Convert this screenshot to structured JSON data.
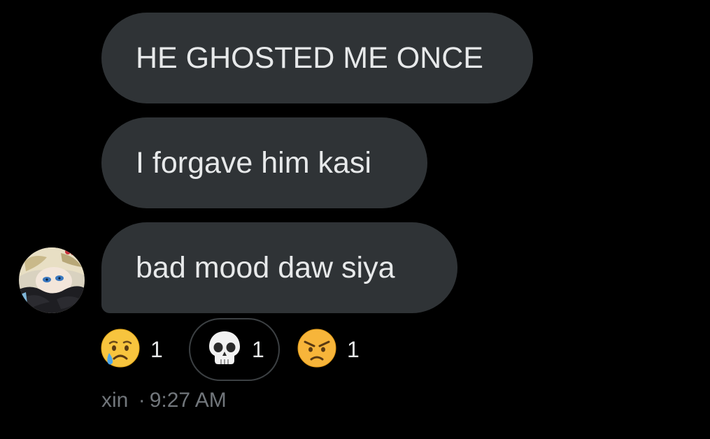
{
  "messages": [
    {
      "text": "HE GHOSTED ME ONCE"
    },
    {
      "text": "I forgave him kasi"
    },
    {
      "text": "bad mood daw siya"
    }
  ],
  "reactions": [
    {
      "emoji": "crying-face-icon",
      "count": "1"
    },
    {
      "emoji": "skull-icon",
      "count": "1",
      "selected": true
    },
    {
      "emoji": "angry-face-icon",
      "count": "1"
    }
  ],
  "meta": {
    "sender": "xin",
    "separator": "·",
    "time": "9:27 AM"
  },
  "colors": {
    "background": "#000000",
    "bubble": "#2f3336",
    "text": "#e7e9ea",
    "muted": "#71767b",
    "selected_border": "#3c4043"
  }
}
